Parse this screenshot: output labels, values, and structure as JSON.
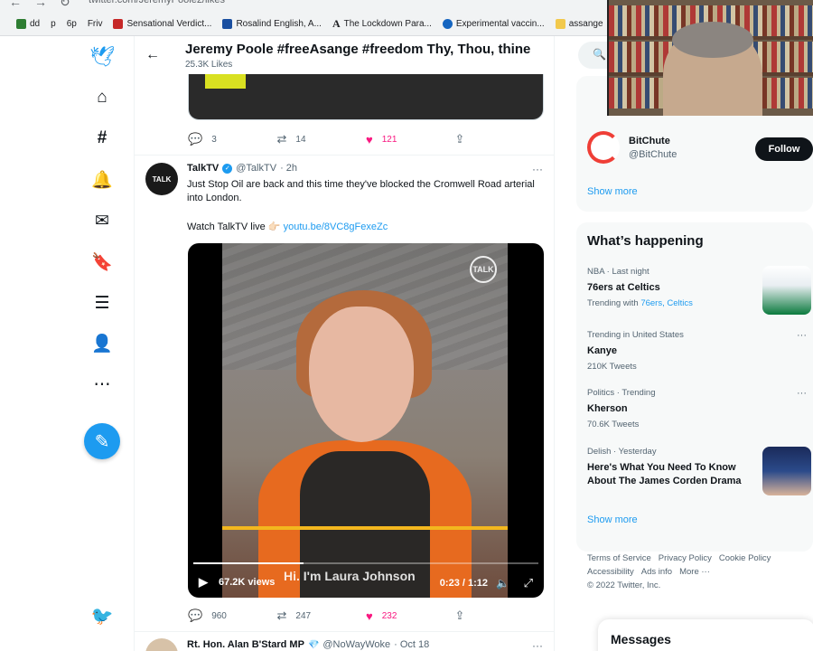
{
  "browser": {
    "url": "twitter.com/JeremyPoole2/likes",
    "bookmarks": [
      {
        "label": "dd",
        "color": "#2e7d32"
      },
      {
        "label": "p",
        "color": "#ffffff"
      },
      {
        "label": "6p",
        "color": "#ffffff"
      },
      {
        "label": "Friv",
        "color": "#ffffff"
      },
      {
        "label": "Sensational Verdict...",
        "color": "#c62828"
      },
      {
        "label": "Rosalind English, A...",
        "color": "#1a4fa0"
      },
      {
        "label": "The Lockdown Para...",
        "color": "#333333"
      },
      {
        "label": "Experimental vaccin...",
        "color": "#1565c0"
      },
      {
        "label": "assange",
        "color": "#f2c94c"
      }
    ]
  },
  "header": {
    "title": "Jeremy Poole #freeAsange #freedom Thy, Thou, thine",
    "subtitle": "25.3K Likes"
  },
  "prev_tweet": {
    "replies": "3",
    "retweets": "14",
    "likes": "121"
  },
  "tweet": {
    "avatar_text": "TALK",
    "name": "TalkTV",
    "handle": "@TalkTV",
    "time": "· 2h",
    "text": "Just Stop Oil are back and this time they've blocked the Cromwell Road arterial into London.",
    "link_prefix": "Watch TalkTV live 👉🏻",
    "link": "youtu.be/8VC8gFexeZc",
    "video": {
      "watermark": "TALK",
      "views": "67.2K views",
      "caption": "Hi. I'm Laura Johnson",
      "time": "0:23 / 1:12",
      "progress": 0.32
    },
    "replies": "960",
    "retweets": "247",
    "likes": "232"
  },
  "next_tweet": {
    "name": "Rt. Hon. Alan B'Stard MP",
    "handle": "@NoWayWoke",
    "time": "· Oct 18"
  },
  "sidebar": {
    "who_to_follow": {
      "name": "BitChute",
      "handle": "@BitChute",
      "follow_label": "Follow",
      "show_more": "Show more"
    },
    "whats_happening": {
      "title": "What’s happening",
      "trends": [
        {
          "meta": "NBA · Last night",
          "topic": "76ers at Celtics",
          "sub_prefix": "Trending with",
          "sub_links": "76ers, Celtics"
        },
        {
          "meta": "Trending in United States",
          "topic": "Kanye",
          "sub": "210K Tweets"
        },
        {
          "meta": "Politics · Trending",
          "topic": "Kherson",
          "sub": "70.6K Tweets"
        },
        {
          "meta": "Delish · Yesterday",
          "topic": "Here's What You Need To Know About The James Corden Drama"
        }
      ],
      "show_more": "Show more"
    },
    "footer": {
      "terms": "Terms of Service",
      "privacy": "Privacy Policy",
      "cookie": "Cookie Policy",
      "accessibility": "Accessibility",
      "ads": "Ads info",
      "more": "More ···",
      "copyright": "© 2022 Twitter, Inc."
    },
    "messages": "Messages"
  },
  "colors": {
    "accent": "#1d9bf0",
    "like": "#f91880"
  }
}
